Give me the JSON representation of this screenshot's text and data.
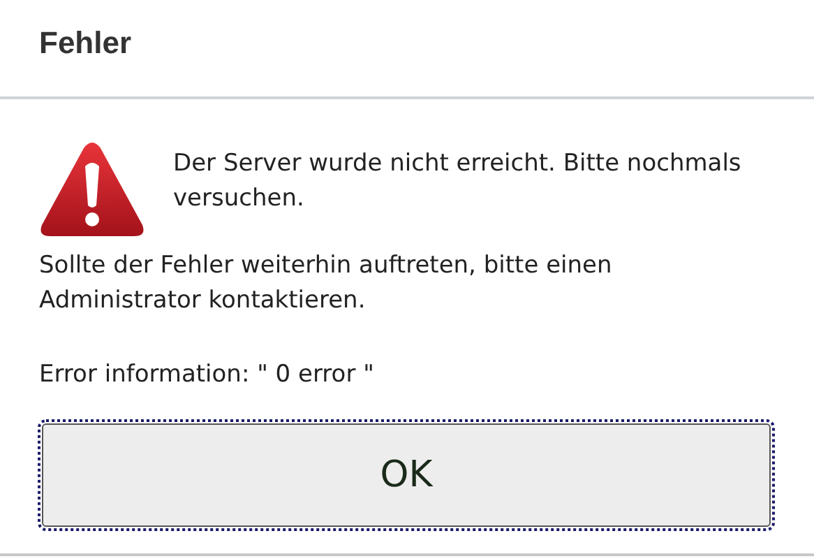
{
  "dialog": {
    "title": "Fehler",
    "message": "Der Server wurde nicht erreicht. Bitte nochmals versuchen.",
    "hint": "Sollte der Fehler weiterhin auftreten, bitte einen Administrator kontaktieren.",
    "details": "Error information: \" 0 error \"",
    "button": {
      "label": "OK",
      "focused": true
    }
  }
}
